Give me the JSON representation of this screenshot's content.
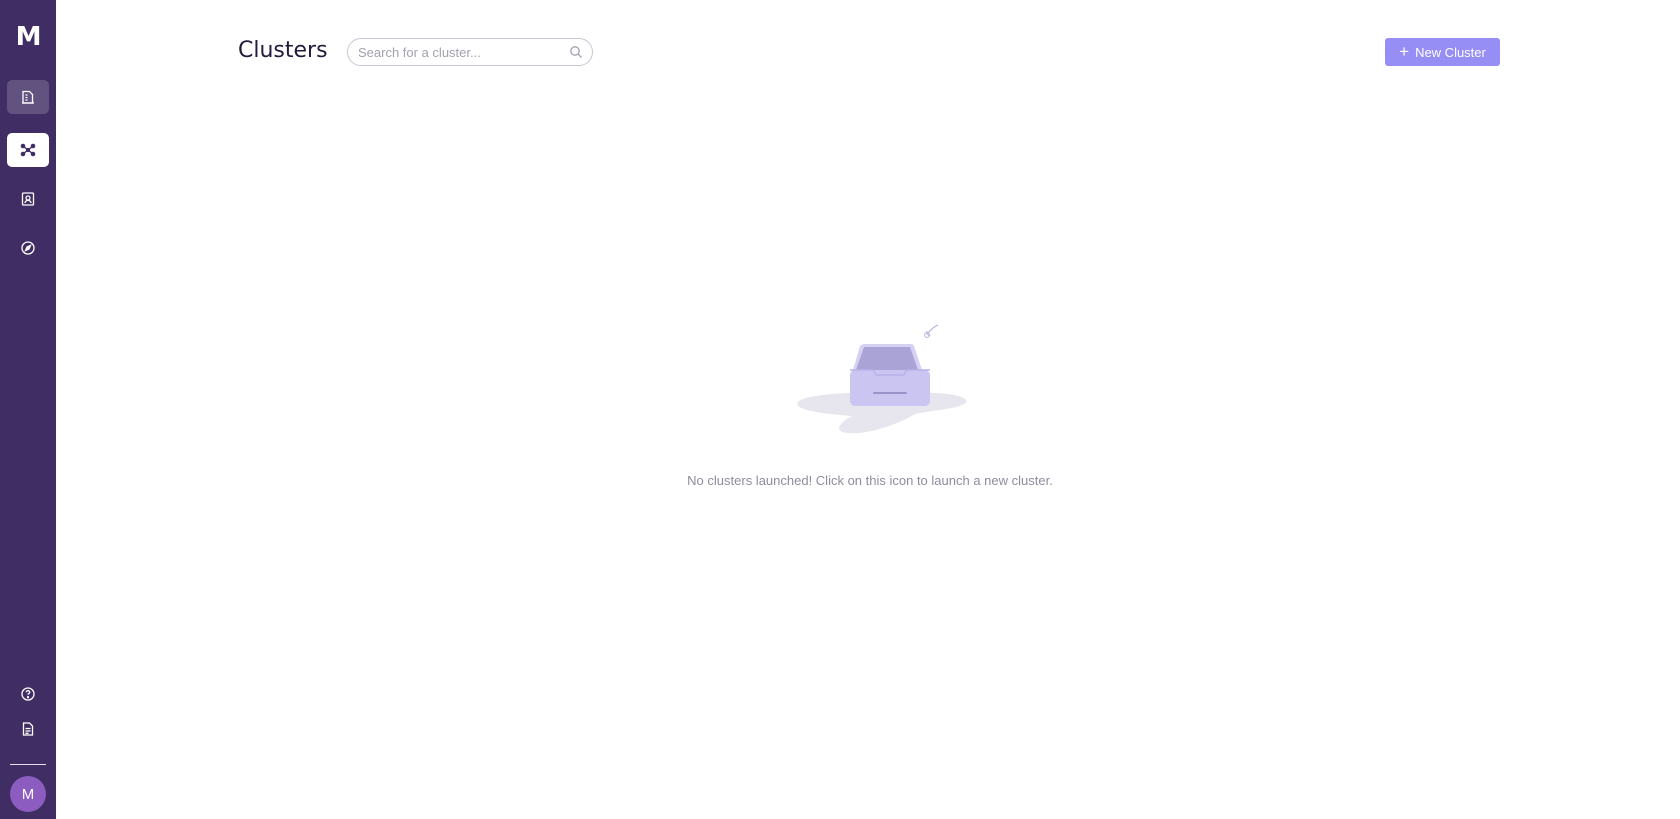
{
  "sidebar": {
    "logo": "M",
    "items": [
      {
        "name": "documents",
        "icon": "building-doc-icon"
      },
      {
        "name": "clusters",
        "icon": "network-nodes-icon",
        "active": true
      },
      {
        "name": "contacts",
        "icon": "contact-card-icon"
      },
      {
        "name": "explore",
        "icon": "compass-icon"
      }
    ],
    "bottom_items": [
      {
        "name": "help",
        "icon": "help-circle-icon"
      },
      {
        "name": "docs",
        "icon": "document-icon"
      }
    ],
    "avatar_initial": "M"
  },
  "header": {
    "title": "Clusters",
    "search": {
      "placeholder": "Search for a cluster...",
      "value": ""
    },
    "new_button": {
      "plus": "+",
      "label": "New Cluster"
    }
  },
  "empty_state": {
    "icon": "empty-inbox-icon",
    "message": "No clusters launched! Click on this icon to launch a new cluster."
  },
  "colors": {
    "sidebar_bg": "#3f2d63",
    "accent": "#978ef5",
    "avatar": "#8d5cc0",
    "title": "#241a3e",
    "muted_text": "#8f8c9e"
  }
}
